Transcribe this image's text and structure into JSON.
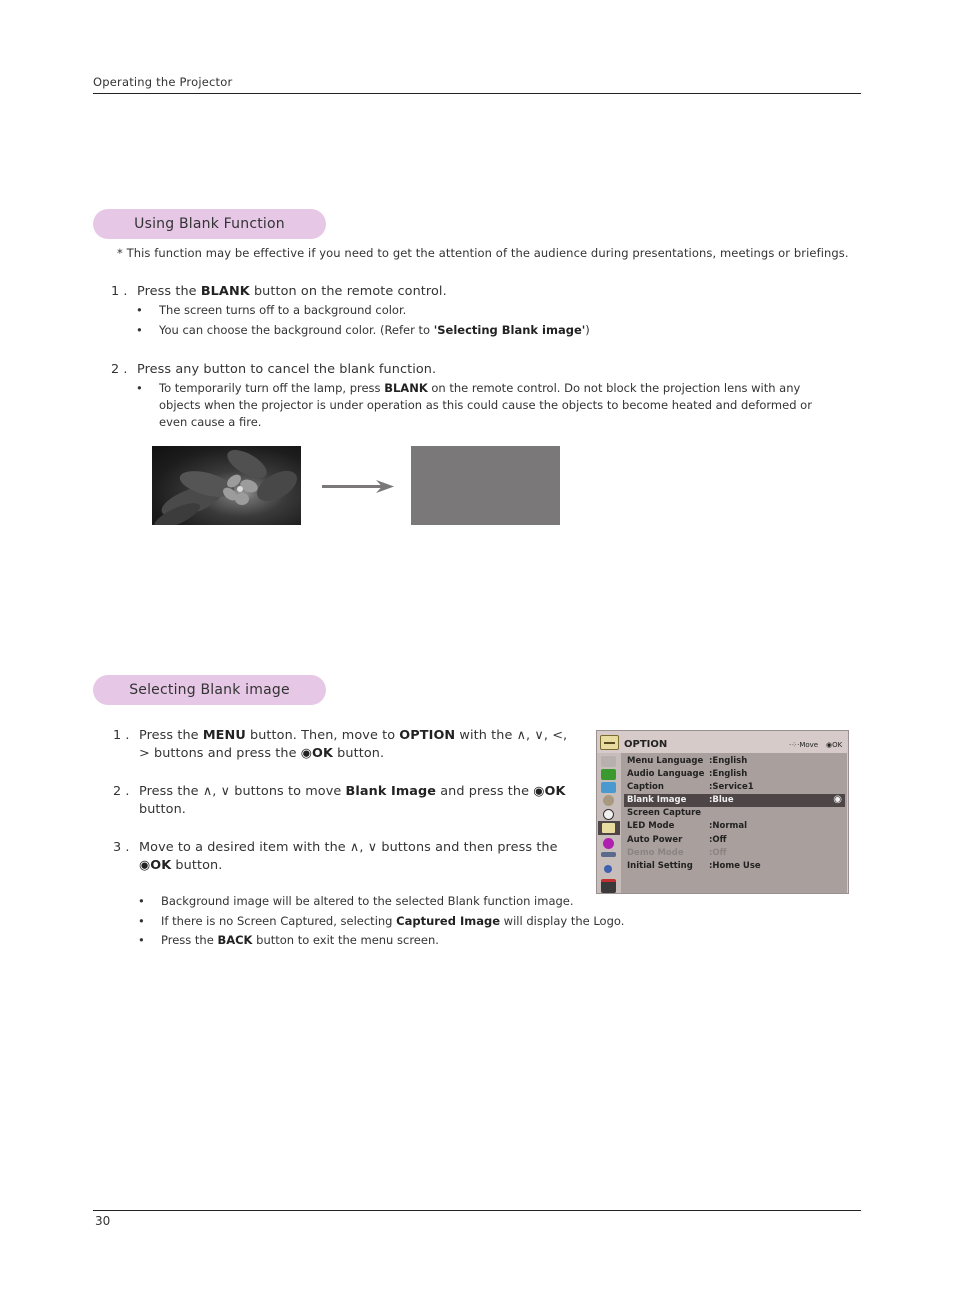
{
  "header": {
    "section_title": "Operating the Projector"
  },
  "section1": {
    "title": "Using Blank Function",
    "note": "* This function may be effective if you need to get the attention of the audience during presentations, meetings or briefings.",
    "step1": {
      "num": "1 .",
      "pre": "Press the ",
      "bold": "BLANK",
      "post": " button on the remote control.",
      "bullets": [
        {
          "text": "The screen turns off to a background color."
        },
        {
          "pre": "You can choose the background color. (Refer to ",
          "bold": "'Selecting Blank image'",
          "post": ")"
        }
      ]
    },
    "step2": {
      "num": "2 .",
      "text": "Press any button to cancel the blank function.",
      "bullet": {
        "pre": "To temporarily turn off the lamp, press ",
        "bold": "BLANK",
        "post": " on the remote control. Do not block the projection lens with any objects when the projector is under operation as this could cause the objects to become heated and deformed or even cause a fire."
      }
    },
    "images": {
      "before": "flower-photo",
      "after": "blank-gray-screen",
      "arrow": "right-arrow"
    }
  },
  "section2": {
    "title": "Selecting Blank image",
    "steps": [
      {
        "num": "1 .",
        "parts": [
          "Press the ",
          "MENU",
          " button. Then, move to ",
          "OPTION",
          " with the ∧, ∨, <,",
          "> buttons and press the ",
          "◉OK",
          " button."
        ]
      },
      {
        "num": "2 .",
        "parts": [
          "Press the ∧, ∨ buttons to move ",
          "Blank Image",
          " and press the ",
          "◉OK",
          "button."
        ]
      },
      {
        "num": "3 .",
        "parts": [
          "Move to a desired item with the ∧, ∨ buttons and then press the",
          "◉OK",
          " button."
        ]
      }
    ],
    "bullets": [
      {
        "pre": "Background image will be altered to the selected Blank function image.",
        "bold": "",
        "post": ""
      },
      {
        "pre": "If there is no Screen Captured, selecting ",
        "bold": "Captured Image",
        "post": " will display the Logo."
      },
      {
        "pre": "Press the ",
        "bold": "BACK",
        "post": " button to exit the menu screen."
      }
    ],
    "osd_menu": {
      "title": "OPTION",
      "hint_move": "Move",
      "hint_ok": "◉OK",
      "rows": [
        {
          "label": "Menu Language",
          "value": ":English",
          "state": "normal"
        },
        {
          "label": "Audio Language",
          "value": ":English",
          "state": "normal"
        },
        {
          "label": "Caption",
          "value": ":Service1",
          "state": "normal"
        },
        {
          "label": "Blank Image",
          "value": ":Blue",
          "state": "selected"
        },
        {
          "label": "Screen Capture",
          "value": "",
          "state": "normal"
        },
        {
          "label": "LED Mode",
          "value": ":Normal",
          "state": "normal"
        },
        {
          "label": "Auto Power",
          "value": ":Off",
          "state": "normal"
        },
        {
          "label": "Demo Mode",
          "value": ":Off",
          "state": "disabled"
        },
        {
          "label": "Initial Setting",
          "value": ":Home Use",
          "state": "normal"
        }
      ],
      "side_icons": [
        "option-icon",
        "picture-icon",
        "screen-icon",
        "display-icon",
        "gear-icon",
        "clock-icon",
        "option-active-icon",
        "info-icon",
        "input-icon",
        "usb-icon",
        "media-icon"
      ]
    }
  },
  "footer": {
    "page_number": "30"
  }
}
